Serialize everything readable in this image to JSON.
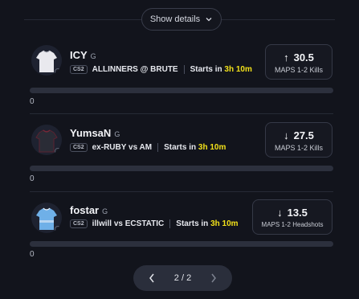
{
  "header": {
    "show_details_label": "Show details"
  },
  "players": [
    {
      "name": "ICY",
      "tag": "G",
      "game": "CS2",
      "match": "ALLINNERS @ BRUTE",
      "starts_prefix": "Starts in",
      "starts_time": "3h 10m",
      "direction": "up",
      "line": "30.5",
      "stat_label": "MAPS 1-2 Kills",
      "progress_count": "0",
      "progress_fraction": 0,
      "jersey_color": "#e9e9ee"
    },
    {
      "name": "YumsaN",
      "tag": "G",
      "game": "CS2",
      "match": "ex-RUBY vs AM",
      "starts_prefix": "Starts in",
      "starts_time": "3h 10m",
      "direction": "down",
      "line": "27.5",
      "stat_label": "MAPS 1-2 Kills",
      "progress_count": "0",
      "progress_fraction": 0,
      "jersey_color": "#2a2c36"
    },
    {
      "name": "fostar",
      "tag": "G",
      "game": "CS2",
      "match": "illwill vs ECSTATIC",
      "starts_prefix": "Starts in",
      "starts_time": "3h 10m",
      "direction": "down",
      "line": "13.5",
      "stat_label": "MAPS 1-2 Headshots",
      "progress_count": "0",
      "progress_fraction": 0,
      "jersey_color": "#6fb0e8"
    }
  ],
  "pagination": {
    "label": "2 / 2"
  },
  "icons": {
    "up": "↑",
    "down": "↓"
  },
  "colors": {
    "accent_time": "#f2e11a",
    "background": "#12141c"
  }
}
